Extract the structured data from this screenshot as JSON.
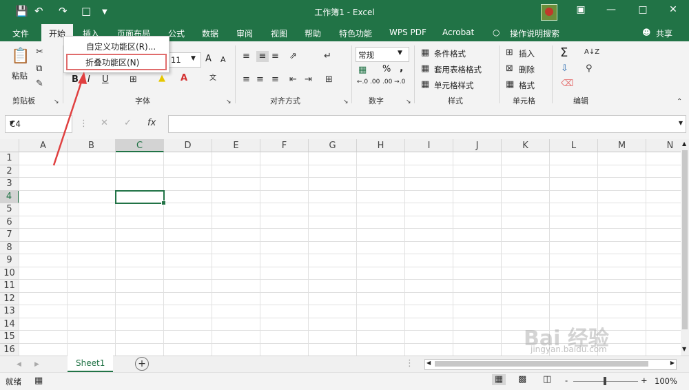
{
  "titlebar": {
    "title": "工作簿1 - Excel",
    "save_icon": "save-icon",
    "undo_icon": "undo-icon",
    "redo_icon": "redo-icon",
    "new_icon": "new-file-icon"
  },
  "menubar": {
    "items": [
      "文件",
      "开始",
      "插入",
      "页面布局",
      "公式",
      "数据",
      "审阅",
      "视图",
      "帮助",
      "特色功能",
      "WPS PDF",
      "Acrobat"
    ],
    "tell_me": "操作说明搜索",
    "share": "共享"
  },
  "context_menu": {
    "item1": "自定义功能区(R)...",
    "item2": "折叠功能区(N)"
  },
  "ribbon": {
    "clipboard": {
      "paste": "粘贴",
      "label": "剪贴板"
    },
    "font": {
      "size": "11",
      "label": "字体",
      "bold": "B",
      "italic": "I",
      "underline": "U",
      "grow": "A",
      "shrink": "A"
    },
    "alignment": {
      "label": "对齐方式"
    },
    "number": {
      "format": "常规",
      "label": "数字",
      "percent": "%",
      "comma": ",",
      "dec_inc": "←.0 .00",
      "dec_dec": ".00 →.0"
    },
    "styles": {
      "cond": "条件格式",
      "table": "套用表格格式",
      "cell": "单元格样式",
      "label": "样式"
    },
    "cells": {
      "insert": "插入",
      "delete": "删除",
      "format": "格式",
      "label": "单元格"
    },
    "editing": {
      "label": "编辑",
      "sum": "Σ",
      "sort": "A↓Z"
    }
  },
  "formula_bar": {
    "name_box": "C4",
    "fx": "fx",
    "cancel": "✕",
    "enter": "✓",
    "value": ""
  },
  "grid": {
    "columns": [
      "A",
      "B",
      "C",
      "D",
      "E",
      "F",
      "G",
      "H",
      "I",
      "J",
      "K",
      "L",
      "M",
      "N"
    ],
    "rows": [
      "1",
      "2",
      "3",
      "4",
      "5",
      "6",
      "7",
      "8",
      "9",
      "10",
      "11",
      "12",
      "13",
      "14",
      "15",
      "16"
    ],
    "active_cell": "C4"
  },
  "sheets": {
    "tabs": [
      "Sheet1"
    ],
    "add": "+"
  },
  "status": {
    "ready": "就绪",
    "zoom": "100%",
    "minus": "-",
    "plus": "+"
  },
  "watermark": {
    "text": "Bai 经验",
    "url": "jingyan.baidu.com"
  },
  "colors": {
    "brand_green": "#217346",
    "highlight_red": "#e06c6c"
  }
}
